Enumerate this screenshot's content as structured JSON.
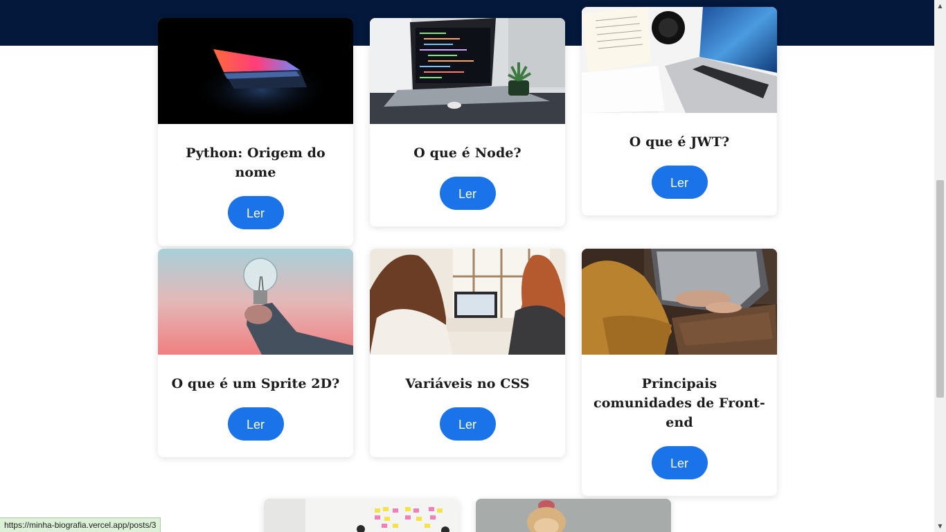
{
  "posts": [
    {
      "title": "Python: Origem do nome",
      "button": "Ler"
    },
    {
      "title": "O que é Node?",
      "button": "Ler"
    },
    {
      "title": "O que é JWT?",
      "button": "Ler"
    },
    {
      "title": "O que é um Sprite 2D?",
      "button": "Ler"
    },
    {
      "title": "Variáveis no CSS",
      "button": "Ler"
    },
    {
      "title": "Principais comunidades de Front-end",
      "button": "Ler"
    }
  ],
  "status_url": "https://minha-biografia.vercel.app/posts/3",
  "colors": {
    "header": "#03183a",
    "button": "#1a73e8"
  }
}
